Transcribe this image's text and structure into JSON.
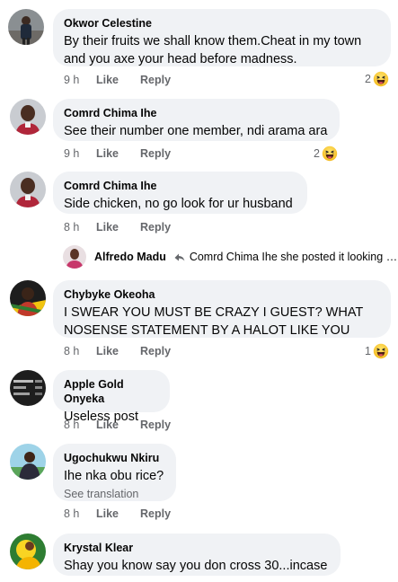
{
  "comments": [
    {
      "author": "Okwor Celestine",
      "text": "By their fruits we shall know them.Cheat in my town\nand you axe your head before madness.",
      "time": "9 h",
      "like": "Like",
      "reply": "Reply",
      "reactions": "2",
      "avatar_icon": "profile-photo"
    },
    {
      "author": "Comrd Chima Ihe",
      "text": "See their number one member, ndi arama ara",
      "time": "9 h",
      "like": "Like",
      "reply": "Reply",
      "reactions": "2",
      "avatar_icon": "profile-photo"
    },
    {
      "author": "Comrd Chima Ihe",
      "text": "Side chicken, no go look for ur husband",
      "time": "8 h",
      "like": "Like",
      "reply": "Reply",
      "avatar_icon": "profile-photo"
    },
    {
      "author": "Chybyke Okeoha",
      "text": "I SWEAR YOU MUST BE CRAZY I GUEST? WHAT\nNOSENSE STATEMENT BY A HALOT LIKE YOU",
      "time": "8 h",
      "like": "Like",
      "reply": "Reply",
      "reactions": "1",
      "avatar_icon": "profile-photo"
    },
    {
      "author": "Apple Gold Onyeka",
      "text": "Useless post",
      "time": "8 h",
      "like": "Like",
      "reply": "Reply",
      "avatar_icon": "profile-photo"
    },
    {
      "author": "Ugochukwu Nkiru",
      "text": "Ihe nka obu rice?",
      "see_translation": "See translation",
      "time": "8 h",
      "like": "Like",
      "reply": "Reply",
      "avatar_icon": "profile-photo"
    },
    {
      "author": "Krystal Klear",
      "text": "Shay you know say you don cross 30...incase",
      "avatar_icon": "profile-photo"
    }
  ],
  "reply_preview": {
    "author": "Alfredo Madu",
    "icon": "reply-arrow-icon",
    "text": "Comrd Chima Ihe she posted it looking f..."
  },
  "reaction_icon": "haha-emoji-icon",
  "colors": {
    "bubble": "#f0f2f5",
    "meta_text": "#65676b",
    "primary_text": "#050505",
    "haha_yellow": "#f7c531"
  }
}
